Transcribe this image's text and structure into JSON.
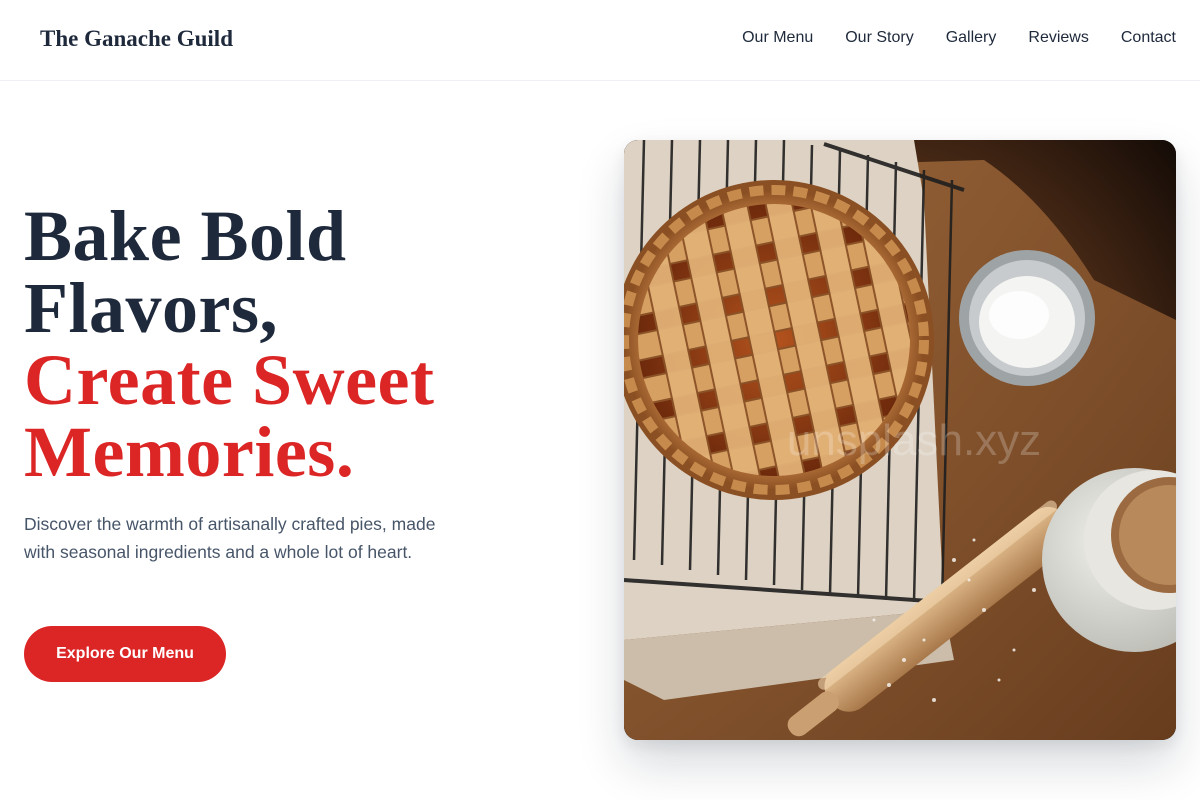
{
  "header": {
    "brand": "The Ganache Guild",
    "nav": [
      "Our Menu",
      "Our Story",
      "Gallery",
      "Reviews",
      "Contact"
    ]
  },
  "hero": {
    "title_line1": "Bake Bold",
    "title_line2": "Flavors,",
    "title_line3": "Create Sweet",
    "title_line4": "Memories.",
    "subtitle": "Discover the warmth of artisanally crafted pies, made with seasonal ingredients and a whole lot of heart.",
    "cta_label": "Explore Our Menu"
  },
  "image": {
    "watermark": "unsplash.xyz"
  },
  "colors": {
    "accent": "#dc2626",
    "heading": "#1e293b",
    "body_text": "#475569"
  }
}
